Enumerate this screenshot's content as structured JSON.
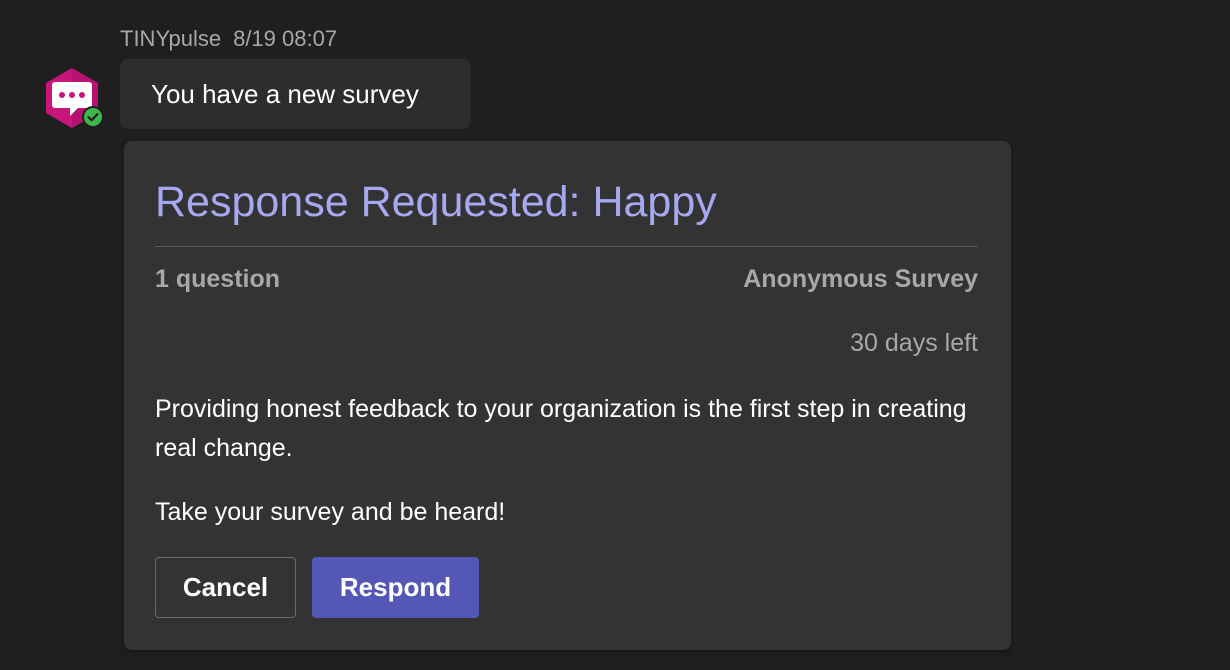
{
  "message": {
    "sender": "TINYpulse",
    "timestamp": "8/19 08:07",
    "text": "You have a new survey",
    "avatar_icon": "chat-bubble-icon",
    "presence_icon": "available-check-icon"
  },
  "card": {
    "title": "Response Requested: Happy",
    "question_count": "1 question",
    "survey_type": "Anonymous Survey",
    "time_left": "30 days left",
    "body": "Providing honest feedback to your organization is the first step in creating real change.",
    "cta": "Take your survey and be heard!",
    "actions": {
      "cancel_label": "Cancel",
      "respond_label": "Respond"
    }
  },
  "colors": {
    "background": "#1f1f1f",
    "bubble": "#2d2d2d",
    "card": "#333333",
    "title": "#a6a8f0",
    "muted": "#a8a8a8",
    "primary_button": "#5457b5",
    "avatar": "#c8157a",
    "presence": "#3fb84b"
  }
}
